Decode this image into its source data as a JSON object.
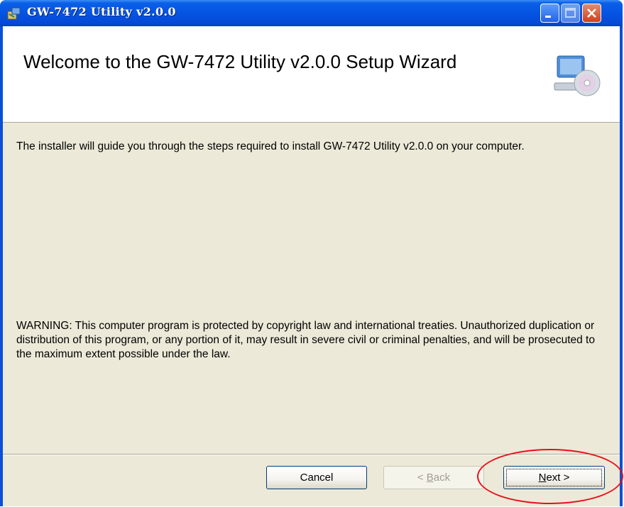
{
  "window": {
    "title": "GW-7472 Utility v2.0.0",
    "controls": {
      "minimize": "minimize-icon",
      "maximize": "maximize-icon",
      "close": "close-icon"
    }
  },
  "banner": {
    "title": "Welcome to the GW-7472 Utility v2.0.0 Setup Wizard",
    "icon": "computer-cd-icon"
  },
  "content": {
    "intro": "The installer will guide you through the steps required to install GW-7472 Utility v2.0.0 on your computer.",
    "warning": "WARNING: This computer program is protected by copyright law and international treaties. Unauthorized duplication or distribution of this program, or any portion of it, may result in severe civil or criminal penalties, and will be prosecuted to the maximum extent possible under the law."
  },
  "buttons": {
    "cancel": "Cancel",
    "back_prefix": "< ",
    "back_access": "B",
    "back_rest": "ack",
    "next_access": "N",
    "next_rest": "ext >"
  },
  "colors": {
    "titlebar": "#0554e3",
    "client_bg": "#ece9d8",
    "highlight": "#e8101a"
  }
}
